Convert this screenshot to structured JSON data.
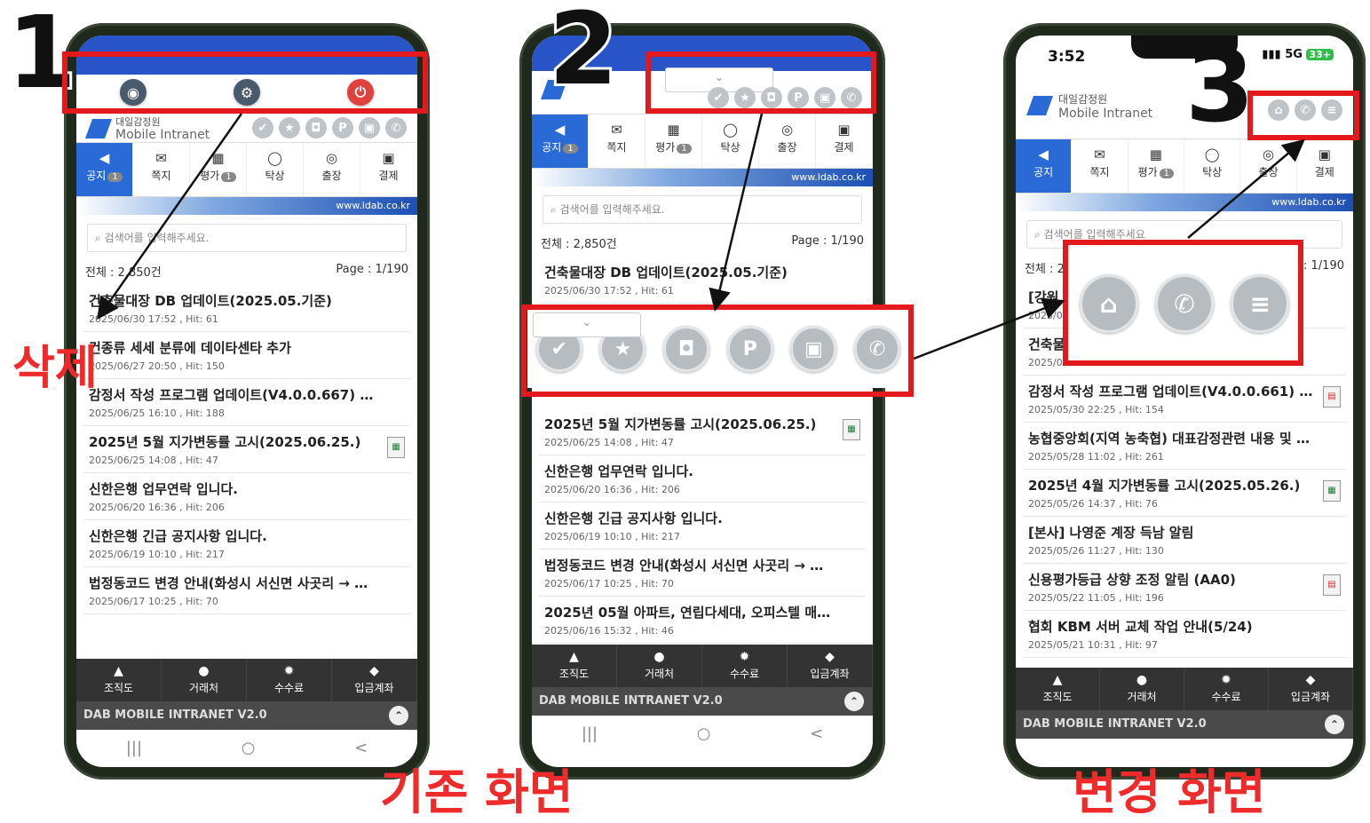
{
  "panels": {
    "p1": {
      "number": "1",
      "statusbar": {
        "time": "",
        "right": ""
      },
      "toolbar": {
        "icon_camera": "◉",
        "icon_settings": "⚙",
        "icon_power": "⏻"
      },
      "logo": {
        "line1": "대일감정원",
        "line2": "Mobile Intranet"
      },
      "header_icons": [
        "✔",
        "★",
        "◘",
        "P",
        "▣",
        "✆"
      ],
      "search_placeholder": "검색어를 입력해주세요.",
      "total": "전체 : 2,850건",
      "page": "Page : 1/190",
      "items": [
        {
          "title": "건축물대장 DB 업데이트(2025.05.기준)",
          "meta": "2025/06/30 17:52 , Hit: 61",
          "file": ""
        },
        {
          "title": "건종류 세세 분류에 데이타센타 추가",
          "meta": "2025/06/27 20:50 , Hit: 150",
          "file": ""
        },
        {
          "title": "감정서 작성 프로그램 업데이트(V4.0.0.667) - 수...",
          "meta": "2025/06/25 16:10 , Hit: 188",
          "file": ""
        },
        {
          "title": "2025년 5월 지가변동률 고시(2025.06.25.)",
          "meta": "2025/06/25 14:08 , Hit: 47",
          "file": "xls"
        },
        {
          "title": "신한은행 업무연락 입니다.",
          "meta": "2025/06/20 16:36 , Hit: 206",
          "file": ""
        },
        {
          "title": "신한은행 긴급 공지사항 입니다.",
          "meta": "2025/06/19 10:10 , Hit: 217",
          "file": ""
        },
        {
          "title": "법정동코드 변경 안내(화성시 서신면 사곳리 → 사...",
          "meta": "2025/06/17 10:25 , Hit: 70",
          "file": ""
        }
      ]
    },
    "p2": {
      "number": "2",
      "items": [
        {
          "title": "2025년 5월 지가변동률 고시(2025.06.25.)",
          "meta": "2025/06/25 14:08 , Hit: 47",
          "file": "xls"
        },
        {
          "title": "신한은행 업무연락 입니다.",
          "meta": "2025/06/20 16:36 , Hit: 206",
          "file": ""
        },
        {
          "title": "신한은행 긴급 공지사항 입니다.",
          "meta": "2025/06/19 10:10 , Hit: 217",
          "file": ""
        },
        {
          "title": "법정동코드 변경 안내(화성시 서신면 사곳리 → 사...",
          "meta": "2025/06/17 10:25 , Hit: 70",
          "file": ""
        },
        {
          "title": "2025년 05월 아파트, 연립다세대, 오피스텔 매매...",
          "meta": "2025/06/16 15:32 , Hit: 46",
          "file": ""
        }
      ],
      "top_item": {
        "title": "건축물대장 DB 업데이트(2025.05.기준)",
        "meta": "2025/06/30 17:52 , Hit: 61"
      },
      "overlay_icons": [
        "✔",
        "★",
        "◘",
        "P",
        "▣",
        "✆"
      ]
    },
    "p3": {
      "number": "3",
      "statusbar": {
        "time": "3:52",
        "signal": "5G",
        "battery": "33+"
      },
      "header_icons": [
        "⌂",
        "✆",
        "≡"
      ],
      "search_placeholder": "검색어를 입력해주세요",
      "total": "전체 : 2",
      "page": ": 1/190",
      "items": [
        {
          "title": "[강원",
          "meta": "2025/0",
          "file": ""
        },
        {
          "title": "건축물",
          "meta": "2025/0",
          "file": ""
        },
        {
          "title": "감정서 작성 프로그램 업데이트(V4.0.0.661) - ...",
          "meta": "2025/05/30 22:25 , Hit: 154",
          "file": "pdf"
        },
        {
          "title": "농협중앙회(지역 농축협) 대표감정관련 내용 및 요약정...",
          "meta": "2025/05/28 11:02 , Hit: 261",
          "file": ""
        },
        {
          "title": "2025년 4월 지가변동률 고시(2025.05.26.)",
          "meta": "2025/05/26 14:37 , Hit: 76",
          "file": "xls"
        },
        {
          "title": "[본사] 나영준 계장 득남 알림",
          "meta": "2025/05/26 11:27 , Hit: 130",
          "file": ""
        },
        {
          "title": "신용평가등급 상향 조정 알림 (AA0)",
          "meta": "2025/05/22 11:05 , Hit: 196",
          "file": "pdf"
        },
        {
          "title": "협회 KBM 서버 교체 작업 안내(5/24)",
          "meta": "2025/05/21 10:31 , Hit: 97",
          "file": ""
        }
      ],
      "overlay_icons": [
        "⌂",
        "✆",
        "≡"
      ]
    }
  },
  "tabs": [
    {
      "icon": "◀",
      "label": "공지",
      "badge": "1"
    },
    {
      "icon": "✉",
      "label": "쪽지",
      "badge": ""
    },
    {
      "icon": "▦",
      "label": "평가",
      "badge": "1"
    },
    {
      "icon": "◯",
      "label": "탁상",
      "badge": ""
    },
    {
      "icon": "◎",
      "label": "출장",
      "badge": ""
    },
    {
      "icon": "▣",
      "label": "결제",
      "badge": ""
    }
  ],
  "banner": "www.ldab.co.kr",
  "bottom_nav": [
    {
      "icon": "▲",
      "label": "조직도"
    },
    {
      "icon": "●",
      "label": "거래처"
    },
    {
      "icon": "✹",
      "label": "수수료"
    },
    {
      "icon": "◆",
      "label": "입금계좌"
    }
  ],
  "footer": {
    "title": "DAB MOBILE INTRANET V2.0",
    "up": "⌃"
  },
  "android_nav": [
    "|||",
    "○",
    "<"
  ],
  "labels": {
    "delete": "삭제",
    "before": "기존 화면",
    "after": "변경 화면"
  },
  "colors": {
    "red": "#e4191d",
    "blue": "#2a6ad6",
    "dark": "#333333"
  }
}
